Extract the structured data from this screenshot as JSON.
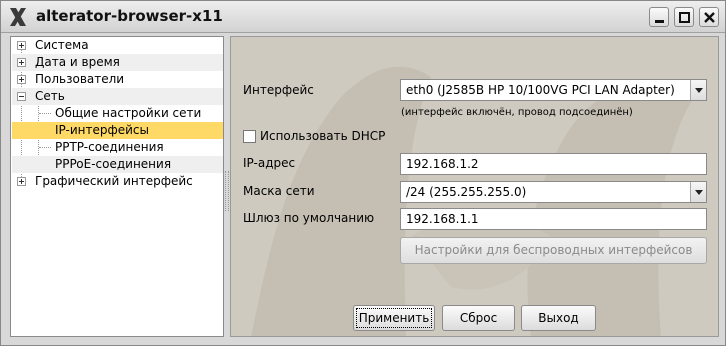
{
  "window": {
    "title": "alterator-browser-x11",
    "app_icon": "x-logo-icon"
  },
  "controls": {
    "minimize_icon": "minimize-icon",
    "maximize_icon": "maximize-icon",
    "close_icon": "close-icon"
  },
  "tree": {
    "items": [
      {
        "label": "Система",
        "expander": "plus"
      },
      {
        "label": "Дата и время",
        "expander": "plus"
      },
      {
        "label": "Пользователи",
        "expander": "plus"
      },
      {
        "label": "Сеть",
        "expander": "minus"
      },
      {
        "label": "Общие настройки сети"
      },
      {
        "label": "IP-интерфейсы",
        "selected": true
      },
      {
        "label": "PPTP-соединения"
      },
      {
        "label": "PPPoE-соединения"
      },
      {
        "label": "Графический интерфейс",
        "expander": "plus"
      }
    ],
    "selected_color": "#ffd966"
  },
  "form": {
    "interface_label": "Интерфейс",
    "interface_value": "eth0 (J2585B HP 10/100VG PCI LAN Adapter)",
    "interface_status": "(интерфейс включён, провод подсоединён)",
    "dhcp_label": "Использовать DHCP",
    "dhcp_checked": false,
    "ip_label": "IP-адрес",
    "ip_value": "192.168.1.2",
    "mask_label": "Маска сети",
    "mask_value": "/24 (255.255.255.0)",
    "gateway_label": "Шлюз по умолчанию",
    "gateway_value": "192.168.1.1",
    "wireless_button": "Настройки для беспроводных интерфейсов"
  },
  "buttons": {
    "apply": "Применить",
    "reset": "Сброс",
    "exit": "Выход"
  }
}
